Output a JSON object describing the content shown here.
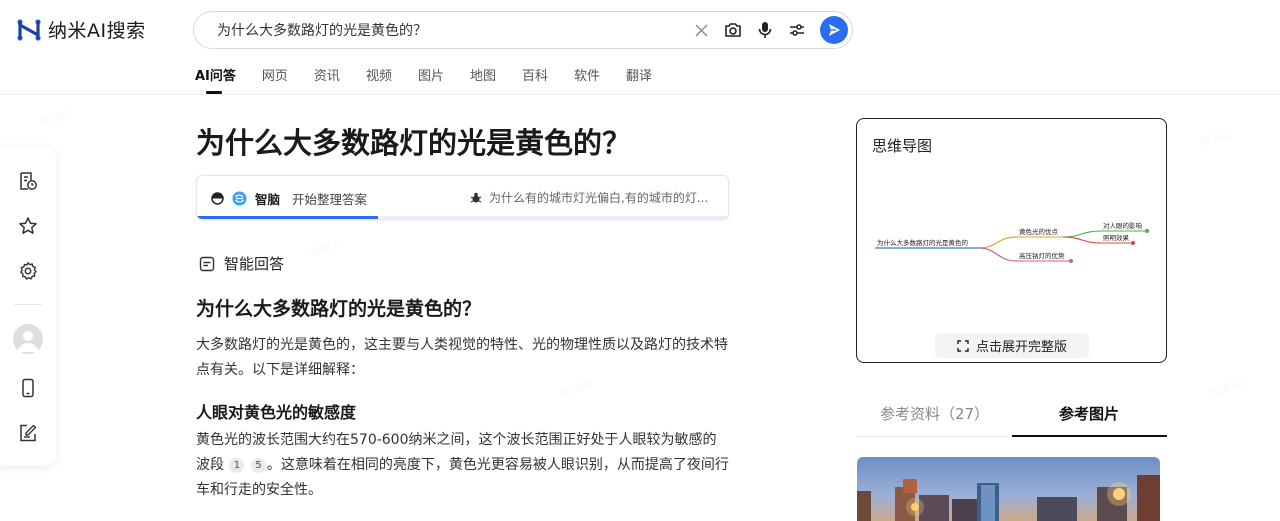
{
  "logo": {
    "text": "纳米AI搜索"
  },
  "search": {
    "query": "为什么大多数路灯的光是黄色的？"
  },
  "tabs": [
    "AI问答",
    "网页",
    "资讯",
    "视频",
    "图片",
    "地图",
    "百科",
    "软件",
    "翻译"
  ],
  "main": {
    "title": "为什么大多数路灯的光是黄色的？",
    "status": {
      "brain_label": "智脑",
      "status_text": "开始整理答案",
      "related_question": "为什么有的城市灯光偏白,有的城市的灯...",
      "progress": 0.34
    },
    "answer_header": "智能回答",
    "h2": "为什么大多数路灯的光是黄色的？",
    "p1": "大多数路灯的光是黄色的，这主要与人类视觉的特性、光的物理性质以及路灯的技术特点有关。以下是详细解释：",
    "h3": "人眼对黄色光的敏感度",
    "p2": {
      "part1": "黄色光的波长范围大约在570-600纳米之间，这个波长范围正好处于人眼较为敏感的波段",
      "cite1": "1",
      "cite2": "5",
      "part2": "。这意味着在相同的亮度下，黄色光更容易被人眼识别，从而提高了夜间行车和行走的安全性。"
    }
  },
  "mindmap": {
    "title": "思维导图",
    "root": "为什么大多数路灯的光是黄色的",
    "branches": [
      "黄色光的优点",
      "高压钠灯的优势"
    ],
    "leaves": [
      "对人眼的影响",
      "照明效果"
    ],
    "expand_label": "点击展开完整版"
  },
  "reference_tabs": {
    "sources": "参考资料（27）",
    "images": "参考图片"
  },
  "colors": {
    "accent": "#2a6cf2",
    "text": "#1a1a1a"
  }
}
